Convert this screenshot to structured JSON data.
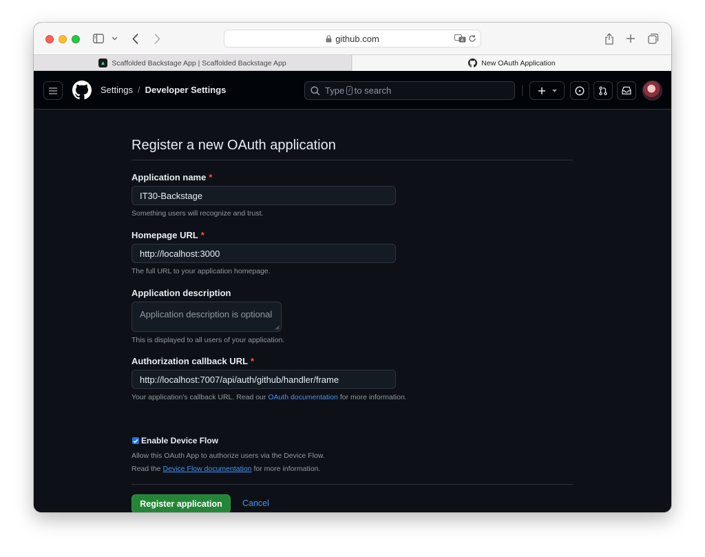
{
  "browser": {
    "address": "github.com",
    "tabs": [
      {
        "label": "Scaffolded Backstage App | Scaffolded Backstage App",
        "active": false
      },
      {
        "label": "New OAuth Application",
        "active": true
      }
    ]
  },
  "header": {
    "breadcrumb_parent": "Settings",
    "breadcrumb_separator": "/",
    "breadcrumb_current": "Developer Settings",
    "search_prefix": "Type",
    "search_key": "/",
    "search_suffix": "to search"
  },
  "form": {
    "title": "Register a new OAuth application",
    "required_marker": "*",
    "app_name": {
      "label": "Application name",
      "value": "IT30-Backstage",
      "note": "Something users will recognize and trust."
    },
    "homepage": {
      "label": "Homepage URL",
      "value": "http://localhost:3000",
      "note": "The full URL to your application homepage."
    },
    "description": {
      "label": "Application description",
      "placeholder": "Application description is optional",
      "note": "This is displayed to all users of your application."
    },
    "callback": {
      "label": "Authorization callback URL",
      "value": "http://localhost:7007/api/auth/github/handler/frame",
      "note_prefix": "Your application's callback URL. Read our",
      "note_link": "OAuth documentation",
      "note_suffix": "for more information."
    },
    "device_flow": {
      "label": "Enable Device Flow",
      "checked": true,
      "note_line1": "Allow this OAuth App to authorize users via the Device Flow.",
      "note_line2_prefix": "Read the",
      "note_line2_link": "Device Flow documentation",
      "note_line2_suffix": "for more information."
    },
    "submit_label": "Register application",
    "cancel_label": "Cancel"
  },
  "colors": {
    "page_bg": "#0d1117",
    "header_bg": "#010409",
    "primary_button": "#238636",
    "link": "#4493f8",
    "required": "#f85149"
  },
  "icons": [
    "sidebar-icon",
    "chevron-down-icon",
    "back-arrow-icon",
    "forward-arrow-icon",
    "lock-icon",
    "translate-icon",
    "reload-icon",
    "share-icon",
    "new-tab-icon",
    "tab-overview-icon",
    "hamburger-icon",
    "github-logo-icon",
    "search-icon",
    "plus-icon",
    "issues-icon",
    "pull-request-icon",
    "inbox-icon",
    "avatar"
  ]
}
